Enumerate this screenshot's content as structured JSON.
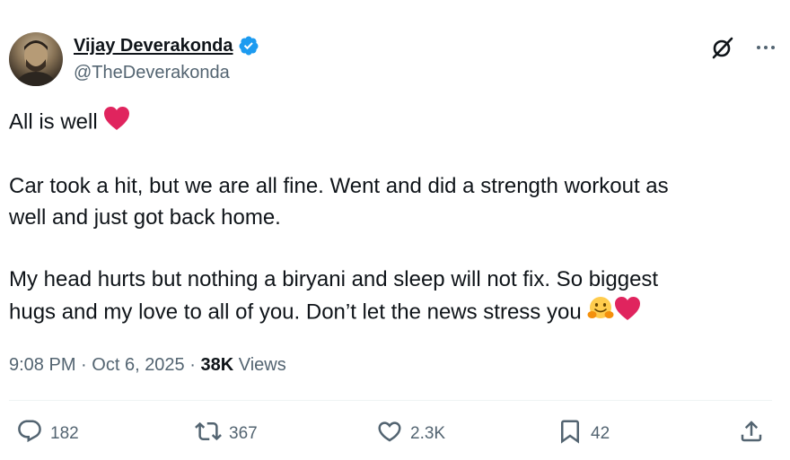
{
  "author": {
    "display_name": "Vijay Deverakonda",
    "handle": "@TheDeverakonda",
    "verified": true
  },
  "header_icons": {
    "grok": "grok-icon",
    "more": "more-options-icon"
  },
  "tweet": {
    "line1": "All is well",
    "line2": "Car took a hit, but we are all fine. Went and did a strength workout as",
    "line3": "well and just got back home.",
    "line4": "My head hurts but nothing a biryani and sleep will not fix. So biggest",
    "line5": "hugs and my love to all of you. Don’t let the news stress you"
  },
  "meta": {
    "time": "9:08 PM",
    "sep1": "·",
    "date": "Oct 6, 2025",
    "sep2": "·",
    "views_count": "38K",
    "views_label": "Views"
  },
  "actions": {
    "replies": "182",
    "reposts": "367",
    "likes": "2.3K",
    "bookmarks": "42"
  },
  "colors": {
    "verified_blue": "#1d9bf0",
    "heart_red": "#e0245e",
    "secondary_text": "#536471"
  }
}
